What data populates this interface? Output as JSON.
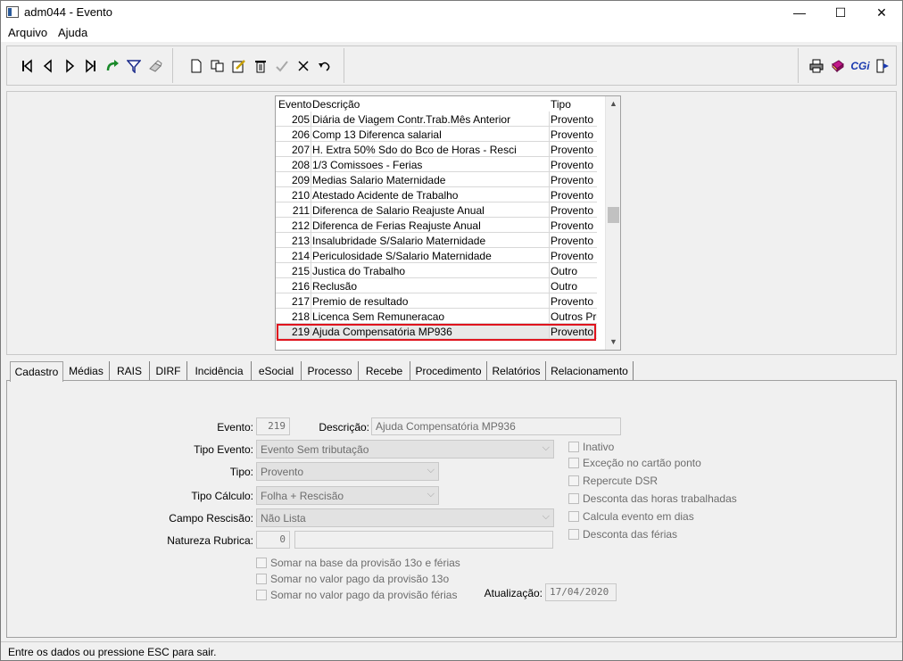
{
  "window": {
    "title": "adm044 - Evento",
    "minimize_glyph": "—",
    "maximize_glyph": "☐",
    "close_glyph": "✕"
  },
  "menu": {
    "items": [
      {
        "label": "Arquivo"
      },
      {
        "label": "Ajuda"
      }
    ]
  },
  "toolbar": {
    "nav_buttons": [
      "first-record-icon",
      "previous-record-icon",
      "next-record-icon",
      "last-record-icon",
      "refresh-icon",
      "filter-icon",
      "eraser-icon"
    ],
    "edit_buttons": [
      "new-document-icon",
      "copy-icon",
      "edit-icon",
      "delete-icon",
      "confirm-icon",
      "cancel-icon",
      "undo-icon"
    ],
    "right_buttons": [
      "print-icon",
      "book-icon",
      "cgi-icon",
      "exit-icon"
    ],
    "cgi_label": "CGi"
  },
  "grid": {
    "columns": [
      "Evento",
      "Descrição",
      "Tipo"
    ],
    "rows": [
      {
        "evento": "205",
        "descricao": "Diária de Viagem Contr.Trab.Mês Anterior",
        "tipo": "Provento"
      },
      {
        "evento": "206",
        "descricao": "Comp 13 Diferenca salarial",
        "tipo": "Provento"
      },
      {
        "evento": "207",
        "descricao": "H. Extra 50% Sdo do Bco de Horas - Resci",
        "tipo": "Provento"
      },
      {
        "evento": "208",
        "descricao": "1/3 Comissoes - Ferias",
        "tipo": "Provento"
      },
      {
        "evento": "209",
        "descricao": "Medias Salario Maternidade",
        "tipo": "Provento"
      },
      {
        "evento": "210",
        "descricao": "Atestado Acidente de Trabalho",
        "tipo": "Provento"
      },
      {
        "evento": "211",
        "descricao": "Diferenca de Salario Reajuste Anual",
        "tipo": "Provento"
      },
      {
        "evento": "212",
        "descricao": "Diferenca de Ferias Reajuste Anual",
        "tipo": "Provento"
      },
      {
        "evento": "213",
        "descricao": "Insalubridade S/Salario Maternidade",
        "tipo": "Provento"
      },
      {
        "evento": "214",
        "descricao": "Periculosidade S/Salario Maternidade",
        "tipo": "Provento"
      },
      {
        "evento": "215",
        "descricao": "Justica do Trabalho",
        "tipo": "Outro"
      },
      {
        "evento": "216",
        "descricao": "Reclusão",
        "tipo": "Outro"
      },
      {
        "evento": "217",
        "descricao": "Premio de resultado",
        "tipo": "Provento"
      },
      {
        "evento": "218",
        "descricao": "Licenca Sem Remuneracao",
        "tipo": "Outros Pro"
      },
      {
        "evento": "219",
        "descricao": "Ajuda Compensatória MP936",
        "tipo": "Provento"
      }
    ],
    "selected_index": 14
  },
  "tabs": [
    {
      "label": "Cadastro",
      "active": true
    },
    {
      "label": "Médias"
    },
    {
      "label": "RAIS"
    },
    {
      "label": "DIRF"
    },
    {
      "label": "Incidência"
    },
    {
      "label": "eSocial"
    },
    {
      "label": "Processo"
    },
    {
      "label": "Recebe"
    },
    {
      "label": "Procedimento"
    },
    {
      "label": "Relatórios"
    },
    {
      "label": "Relacionamento"
    }
  ],
  "form": {
    "evento_label": "Evento:",
    "evento_value": "219",
    "descricao_label": "Descrição:",
    "descricao_value": "Ajuda Compensatória MP936",
    "tipo_evento_label": "Tipo Evento:",
    "tipo_evento_value": "Evento Sem tributação",
    "tipo_label": "Tipo:",
    "tipo_value": "Provento",
    "tipo_calculo_label": "Tipo Cálculo:",
    "tipo_calculo_value": "Folha + Rescisão",
    "campo_rescisao_label": "Campo Rescisão:",
    "campo_rescisao_value": "Não Lista",
    "natureza_label": "Natureza Rubrica:",
    "natureza_value": "0",
    "natureza_desc_value": "",
    "atualizacao_label": "Atualização:",
    "atualizacao_value": "17/04/2020",
    "checks_right": [
      {
        "label": "Inativo",
        "checked": false
      },
      {
        "label": "Exceção no cartão ponto",
        "checked": false
      },
      {
        "label": "Repercute DSR",
        "checked": false
      },
      {
        "label": "Desconta das horas trabalhadas",
        "checked": false
      },
      {
        "label": "Calcula evento em dias",
        "checked": false
      },
      {
        "label": "Desconta das férias",
        "checked": false
      }
    ],
    "checks_bottom": [
      {
        "label": "Somar na base da provisão 13o e férias",
        "checked": false
      },
      {
        "label": "Somar no valor pago da provisão 13o",
        "checked": false
      },
      {
        "label": "Somar no valor pago da provisão férias",
        "checked": false
      }
    ]
  },
  "status": {
    "text": "Entre os dados ou pressione ESC para sair."
  },
  "colors": {
    "selection_outline": "#e0141e",
    "window_bg": "#f0f0f0"
  }
}
